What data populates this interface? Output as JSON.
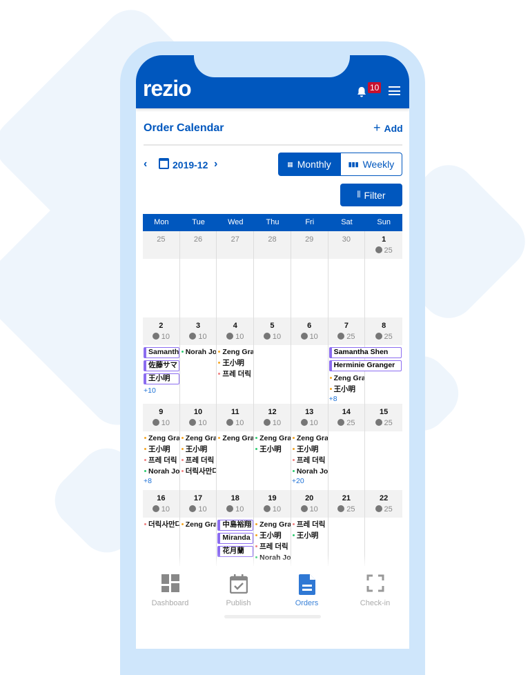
{
  "app": {
    "logo": "rezio",
    "notification_count": "10"
  },
  "page": {
    "title": "Order Calendar",
    "add_label": "Add",
    "month": "2019-12"
  },
  "view": {
    "monthly": "Monthly",
    "weekly": "Weekly",
    "active": "Monthly",
    "filter": "Filter"
  },
  "colors": {
    "primary": "#0057be",
    "orange": "#f5a623",
    "pink": "#f08080",
    "green": "#2ecc71",
    "event_border": "#8b6cf0"
  },
  "weekdays": [
    "Mon",
    "Tue",
    "Wed",
    "Thu",
    "Fri",
    "Sat",
    "Sun"
  ],
  "weeks": [
    {
      "days": [
        {
          "d": "25",
          "other": true
        },
        {
          "d": "26",
          "other": true
        },
        {
          "d": "27",
          "other": true
        },
        {
          "d": "28",
          "other": true
        },
        {
          "d": "29",
          "other": true
        },
        {
          "d": "30",
          "other": true
        },
        {
          "d": "1",
          "cap": "25"
        }
      ]
    },
    {
      "spans": [
        {
          "label": "Samantha Shen",
          "start": 5,
          "len": 2,
          "row": 0
        },
        {
          "label": "Herminie Granger",
          "start": 5,
          "len": 2,
          "row": 1
        }
      ],
      "days": [
        {
          "d": "2",
          "cap": "10",
          "boxes": [
            "Samanth",
            "佐藤サマ",
            "王小明"
          ],
          "more": "+10"
        },
        {
          "d": "3",
          "cap": "10",
          "events": [
            {
              "t": "Norah Jo",
              "c": "green"
            }
          ]
        },
        {
          "d": "4",
          "cap": "10",
          "events": [
            {
              "t": "Zeng Gra",
              "c": "orange"
            },
            {
              "t": "王小明",
              "c": "orange"
            },
            {
              "t": "프레 더릭",
              "c": "pink"
            }
          ]
        },
        {
          "d": "5",
          "cap": "10"
        },
        {
          "d": "6",
          "cap": "10"
        },
        {
          "d": "7",
          "cap": "25",
          "offset": 2,
          "events": [
            {
              "t": "Zeng Gra",
              "c": "orange"
            },
            {
              "t": "王小明",
              "c": "orange"
            }
          ],
          "more": "+8"
        },
        {
          "d": "8",
          "cap": "25"
        }
      ]
    },
    {
      "days": [
        {
          "d": "9",
          "cap": "10",
          "events": [
            {
              "t": "Zeng Gra",
              "c": "orange"
            },
            {
              "t": "王小明",
              "c": "orange"
            },
            {
              "t": "프레 더릭",
              "c": "pink"
            },
            {
              "t": "Norah Jo",
              "c": "green"
            }
          ],
          "more": "+8"
        },
        {
          "d": "10",
          "cap": "10",
          "events": [
            {
              "t": "Zeng Gra",
              "c": "orange"
            },
            {
              "t": "王小明",
              "c": "orange"
            },
            {
              "t": "프레 더릭",
              "c": "pink"
            },
            {
              "t": "더릭사만다",
              "c": "pink"
            }
          ]
        },
        {
          "d": "11",
          "cap": "10",
          "events": [
            {
              "t": "Zeng Gra",
              "c": "orange"
            }
          ]
        },
        {
          "d": "12",
          "cap": "10",
          "events": [
            {
              "t": "Zeng Gra",
              "c": "green"
            },
            {
              "t": "王小明",
              "c": "green"
            }
          ]
        },
        {
          "d": "13",
          "cap": "10",
          "events": [
            {
              "t": "Zeng Gra",
              "c": "orange"
            },
            {
              "t": "王小明",
              "c": "orange"
            },
            {
              "t": "프레 더릭",
              "c": "pink"
            },
            {
              "t": "Norah Jo",
              "c": "green"
            }
          ],
          "more": "+20"
        },
        {
          "d": "14",
          "cap": "25"
        },
        {
          "d": "15",
          "cap": "25"
        }
      ]
    },
    {
      "days": [
        {
          "d": "16",
          "cap": "10",
          "events": [
            {
              "t": "더릭사만다",
              "c": "pink"
            }
          ]
        },
        {
          "d": "17",
          "cap": "10",
          "events": [
            {
              "t": "Zeng Gra",
              "c": "orange"
            }
          ]
        },
        {
          "d": "18",
          "cap": "10",
          "boxes": [
            "中島裕翔",
            "Miranda",
            "花月蘭"
          ]
        },
        {
          "d": "19",
          "cap": "10",
          "events": [
            {
              "t": "Zeng Gra",
              "c": "orange"
            },
            {
              "t": "王小明",
              "c": "orange"
            },
            {
              "t": "프레 더릭",
              "c": "pink"
            },
            {
              "t": "Norah Jo",
              "c": "green"
            }
          ]
        },
        {
          "d": "20",
          "cap": "10",
          "events": [
            {
              "t": "프레 더릭",
              "c": "pink"
            },
            {
              "t": "王小明",
              "c": "green"
            }
          ]
        },
        {
          "d": "21",
          "cap": "25"
        },
        {
          "d": "22",
          "cap": "25"
        }
      ]
    }
  ],
  "bottom_nav": [
    {
      "label": "Dashboard",
      "icon": "dashboard-icon"
    },
    {
      "label": "Publish",
      "icon": "calendar-check-icon"
    },
    {
      "label": "Orders",
      "icon": "document-icon",
      "active": true
    },
    {
      "label": "Check-in",
      "icon": "scan-icon"
    }
  ]
}
